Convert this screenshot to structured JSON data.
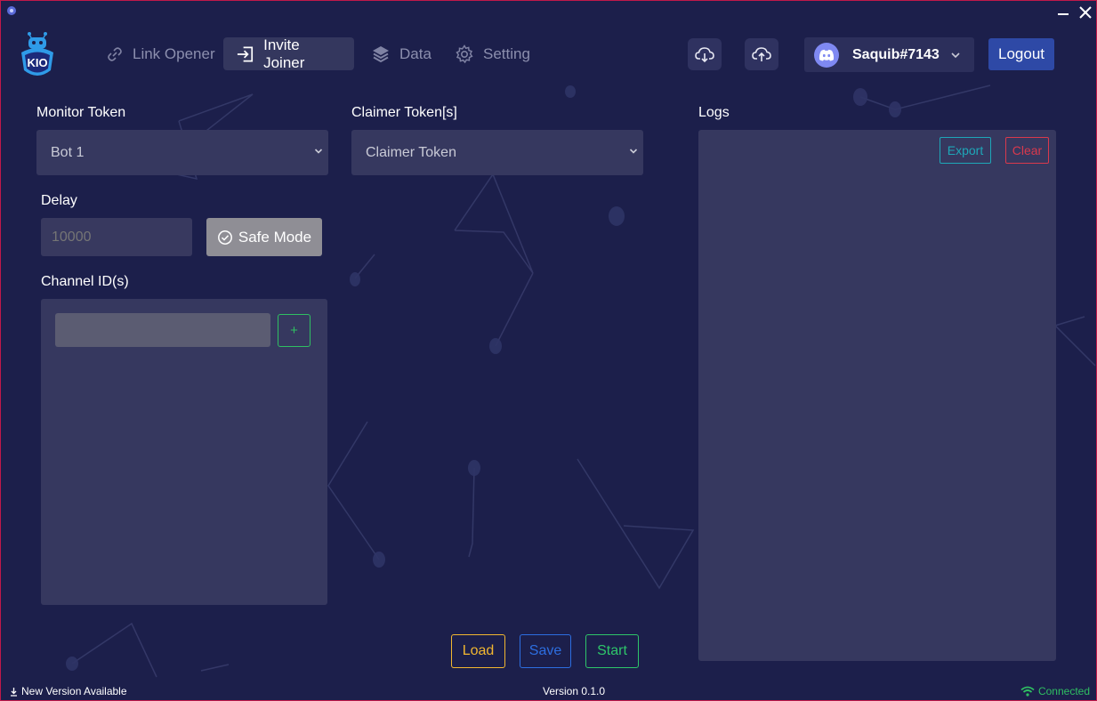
{
  "colors": {
    "background": "#1c1f4b",
    "panel": "#36385f",
    "accent_blue": "#2e49a6",
    "load": "#f2b730",
    "save": "#2d6ee0",
    "start": "#2ec56a",
    "export": "#1ea7b8",
    "clear": "#d9394d",
    "connected": "#2fbf62"
  },
  "app": {
    "logo_text": "KIO"
  },
  "nav": {
    "items": [
      {
        "label": "Link Opener",
        "icon": "link-icon",
        "active": false
      },
      {
        "label": "Invite Joiner",
        "icon": "enter-icon",
        "active": true
      },
      {
        "label": "Data",
        "icon": "layers-icon",
        "active": false
      },
      {
        "label": "Setting",
        "icon": "gear-icon",
        "active": false
      }
    ]
  },
  "header": {
    "download_icon": "cloud-download-icon",
    "upload_icon": "cloud-upload-icon",
    "user": {
      "name": "Saquib#7143",
      "icon": "discord-icon"
    },
    "logout_label": "Logout"
  },
  "form": {
    "monitor_token": {
      "label": "Monitor Token",
      "selected": "Bot 1"
    },
    "claimer_token": {
      "label": "Claimer Token[s]",
      "selected": "Claimer Token"
    },
    "delay": {
      "label": "Delay",
      "placeholder": "10000"
    },
    "safe_mode": {
      "label": "Safe Mode",
      "icon": "check-circle-icon"
    },
    "channel": {
      "label": "Channel ID(s)",
      "add_label": "+"
    }
  },
  "logs": {
    "label": "Logs",
    "export_label": "Export",
    "clear_label": "Clear"
  },
  "actions": {
    "load_label": "Load",
    "save_label": "Save",
    "start_label": "Start"
  },
  "status": {
    "update_text": "New Version Available",
    "version_text": "Version 0.1.0",
    "connection_text": "Connected"
  }
}
